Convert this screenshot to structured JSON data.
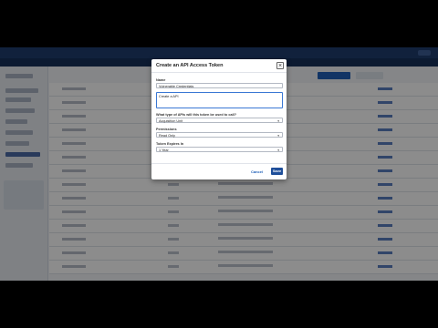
{
  "dialog": {
    "title": "Create an API Access Token",
    "close_icon": "close-icon",
    "name_label": "Name",
    "name_value": "Vulnerable Credentials",
    "description_value": "Create a API",
    "api_type_label": "What type of APIs will this token be used to call?",
    "api_type_value": "Acquisition Unit",
    "permissions_label": "Permissions",
    "permissions_value": "Read Only",
    "expires_label": "Token Expires In",
    "expires_value": "1 Year",
    "cancel_label": "Cancel",
    "save_label": "Save"
  },
  "colors": {
    "primary": "#1f4f9a",
    "header": "#1f3c6d"
  }
}
